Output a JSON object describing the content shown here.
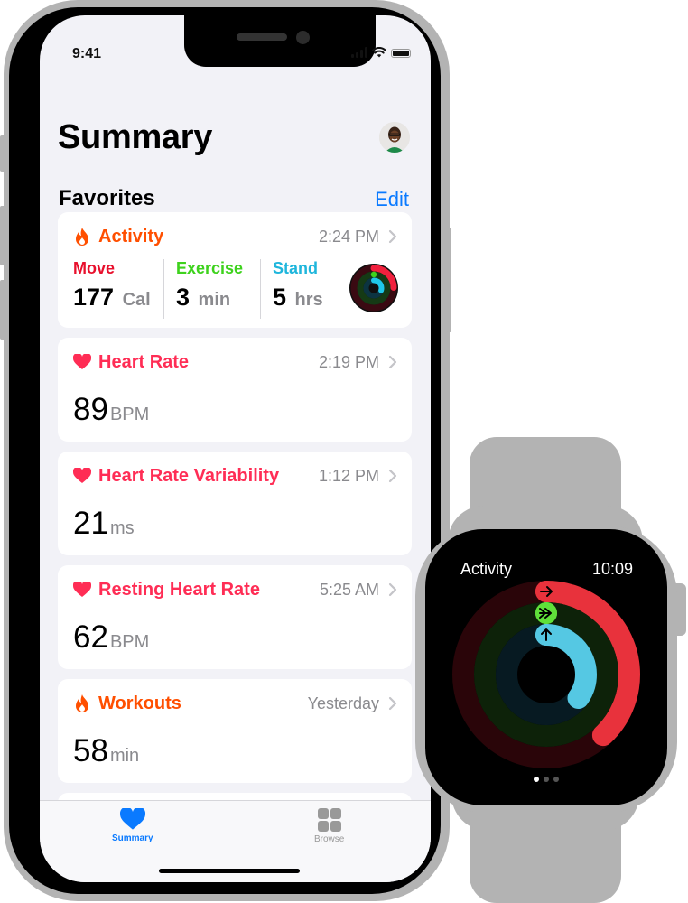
{
  "phone": {
    "status_bar": {
      "time": "9:41",
      "icons": [
        "signal-icon",
        "wifi-icon",
        "battery-icon"
      ]
    },
    "page_title": "Summary",
    "profile_avatar": "profile-avatar",
    "section_title": "Favorites",
    "edit_label": "Edit",
    "activity_card": {
      "title": "Activity",
      "icon": "flame-icon",
      "time": "2:24 PM",
      "color": "#ff4f00",
      "metrics": [
        {
          "label": "Move",
          "value": "177",
          "unit": "Cal",
          "color": "#e8102d"
        },
        {
          "label": "Exercise",
          "value": "3",
          "unit": "min",
          "color": "#3ed21d"
        },
        {
          "label": "Stand",
          "value": "5",
          "unit": "hrs",
          "color": "#1fb6dc"
        }
      ]
    },
    "cards": [
      {
        "title": "Heart Rate",
        "icon": "heart-icon",
        "time": "2:19 PM",
        "value": "89",
        "unit": "BPM",
        "color": "#ff2d55"
      },
      {
        "title": "Heart Rate Variability",
        "icon": "heart-icon",
        "time": "1:12 PM",
        "value": "21",
        "unit": "ms",
        "color": "#ff2d55"
      },
      {
        "title": "Resting Heart Rate",
        "icon": "heart-icon",
        "time": "5:25 AM",
        "value": "62",
        "unit": "BPM",
        "color": "#ff2d55"
      },
      {
        "title": "Workouts",
        "icon": "flame-icon",
        "time": "Yesterday",
        "value": "58",
        "unit": "min",
        "color": "#ff4f00"
      }
    ],
    "tab_bar": {
      "tabs": [
        {
          "label": "Summary",
          "icon": "heart-icon",
          "active": true
        },
        {
          "label": "Browse",
          "icon": "grid-icon",
          "active": false
        }
      ],
      "active_color": "#0a7aff",
      "inactive_color": "#999999"
    }
  },
  "watch": {
    "title": "Activity",
    "time": "10:09",
    "rings": [
      {
        "name": "Move",
        "progress": 0.38,
        "color": "#e8323c",
        "track": "#2a0509",
        "icon": "arrow-right-icon"
      },
      {
        "name": "Exercise",
        "progress": 0.0,
        "color": "#5fe03a",
        "track": "#0d2209",
        "icon": "double-arrow-right-icon"
      },
      {
        "name": "Stand",
        "progress": 0.35,
        "color": "#55c8e3",
        "track": "#071a22",
        "icon": "arrow-up-icon"
      }
    ],
    "page_dots": {
      "count": 3,
      "active": 0
    }
  }
}
